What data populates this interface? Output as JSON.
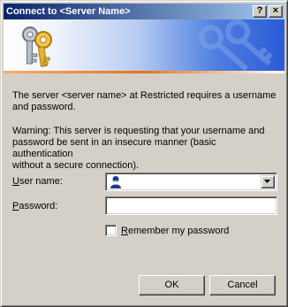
{
  "window": {
    "title": "Connect to <Server Name>",
    "help_button": "?",
    "close_button": "×"
  },
  "banner": {
    "icon": "keys-icon",
    "watermark": "keys-watermark-icon"
  },
  "message": {
    "line1": "The server <server name> at Restricted requires a username",
    "line2": "and password.",
    "warning1": "Warning: This server is requesting that your username and",
    "warning2": "password be sent in an insecure manner (basic authentication",
    "warning3": "without a secure connection)."
  },
  "form": {
    "username_label_key": "U",
    "username_label_rest": "ser name:",
    "username_value": "",
    "username_icon": "user-icon",
    "password_label_key": "P",
    "password_label_rest": "assword:",
    "password_value": "",
    "remember_key": "R",
    "remember_rest": "emember my password",
    "remember_checked": false
  },
  "buttons": {
    "ok": "OK",
    "cancel": "Cancel"
  }
}
